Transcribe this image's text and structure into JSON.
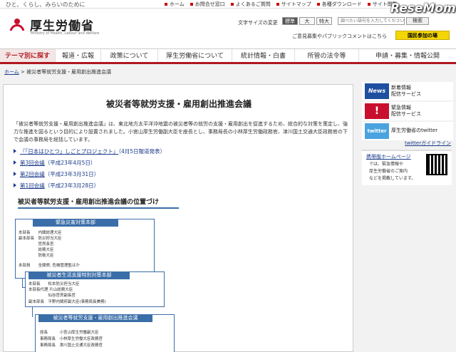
{
  "brand": {
    "tagline": "ひと、くらし、みらいのために",
    "name_ja": "厚生労働省",
    "name_en": "Ministry of Health, Labour and Welfare",
    "watermark": "ReseMom"
  },
  "utility_nav": [
    {
      "label": "ホーム"
    },
    {
      "label": "お問合せ窓口"
    },
    {
      "label": "よくあるご質問"
    },
    {
      "label": "サイトマップ"
    },
    {
      "label": "各種ダウンロード"
    },
    {
      "label": "サイト閲覧"
    }
  ],
  "font_size": {
    "label": "文字サイズの変更",
    "options": [
      "標準",
      "大",
      "特大"
    ],
    "selected": "標準"
  },
  "search": {
    "placeholder": "調べたい語句を入力してください",
    "button": "検索"
  },
  "opinion_link": "ご意見募集やパブリックコメントはこちら",
  "kokumin_button": "国民参加の場",
  "global_nav": [
    {
      "label": "テーマ別に探す"
    },
    {
      "label": "報道・広報"
    },
    {
      "label": "政策について"
    },
    {
      "label": "厚生労働省について"
    },
    {
      "label": "統計情報・白書"
    },
    {
      "label": "所管の法令等"
    },
    {
      "label": "申請・募集・情報公開"
    }
  ],
  "breadcrumb": {
    "home": "ホーム",
    "separator": ">",
    "current": "被災者等就労支援・雇用創出推進会議"
  },
  "main": {
    "title": "被災者等就労支援・雇用創出推進会議",
    "intro": "「被災者等就労支援・雇用創出推進会議」は、東北地方太平洋沖地震の被災者等の就労の支援・雇用創出を促進するため、総合的な対策を策定し、強力な推進を図るという目的により設置されました。小宮山厚生労働副大臣を座長とし、事務局長の小林厚生労働政務官、津川国土交通大臣政務官の下で会議の事務局を総括しています。",
    "links": [
      {
        "text": "『「日本はひとつ」しごとプロジェクト』",
        "date": "（4月5日報道発表）"
      },
      {
        "text": "第3回会議",
        "date": "（平成23年4月5日）"
      },
      {
        "text": "第2回会議",
        "date": "（平成23年3月31日）"
      },
      {
        "text": "第1回会議",
        "date": "（平成23年3月28日）"
      }
    ],
    "org_title": "被災者等就労支援・雇用創出推進会議の位置づけ",
    "org": {
      "box1": {
        "head": "緊急災害対策本部",
        "lines": [
          "本部長　　内閣総理大臣",
          "副本部長　防災担当大臣",
          "　　　　　官房長官",
          "　　　　　総務大臣",
          "　　　　　防衛大臣",
          "本部員　　全閣僚, 危機管理監ほか"
        ]
      },
      "box2": {
        "head": "被災者生活支援特別対策本部",
        "lines": [
          "本部長　　松本防災担当大臣",
          "本部長代理 片山総務大臣",
          "　　　　　仙谷官房副長官",
          "副本部長　平野内閣府副大臣(事務局長兼務)"
        ]
      },
      "box3": {
        "head": "被災者等就労支援・雇用創出推進会議",
        "lines": [
          "座長　　　小宮山厚生労働副大臣",
          "事務局長　小林厚生労働大臣政務官",
          "事務局長　津川国土交通大臣政務官"
        ]
      }
    }
  },
  "sidebar": {
    "items": [
      {
        "icon": "News",
        "icon_color": "#1f4fa0",
        "line1": "新着情報",
        "line2": "配信サービス"
      },
      {
        "icon": "!",
        "icon_color": "#c8102e",
        "line1": "緊急情報",
        "line2": "配信サービス"
      },
      {
        "icon": "twitter",
        "icon_color": "#4aa3df",
        "line1": "厚生労働省のtwitter",
        "line2": ""
      }
    ],
    "twitter_guide": "twitterガイドライン",
    "mobile": {
      "title": "携帯版ホームページ",
      "text1": "では、緊急情報や",
      "text2": "厚生労働省のご案内",
      "text3": "などを掲載しています。"
    }
  }
}
